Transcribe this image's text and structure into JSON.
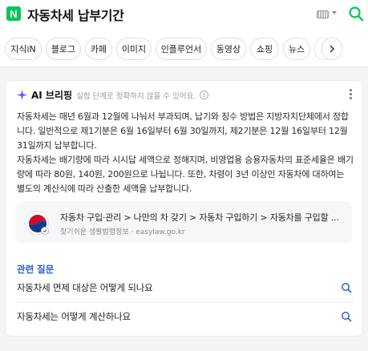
{
  "header": {
    "logo_letter": "N",
    "query": "자동차세 납부기간",
    "icons": [
      "keyboard-icon",
      "dropdown-caret-icon",
      "search-icon"
    ],
    "brand_color": "#03c75a"
  },
  "tabs": [
    {
      "label": "지식iN"
    },
    {
      "label": "블로그"
    },
    {
      "label": "카페"
    },
    {
      "label": "이미지"
    },
    {
      "label": "인플루언서"
    },
    {
      "label": "동영상"
    },
    {
      "label": "쇼핑"
    },
    {
      "label": "뉴스"
    },
    {
      "label": "쇼"
    }
  ],
  "ai_briefing": {
    "title": "AI 브리핑",
    "subtitle": "실험 단계로 정확하지 않을 수 있어요.",
    "paragraphs": [
      "자동차세는 매년 6월과 12월에 나눠서 부과되며, 납기와 징수 방법은 지방자치단체에서 정합니다. 일반적으로 제1기분은 6월 16일부터 6월 30일까지, 제2기분은 12월 16일부터 12월 31일까지 납부합니다.",
      "자동차세는 배기량에 따라 시시답 세액으로 정해지며, 비영업용 승용자동차의 표준세율은 배기량에 따라 80원, 140원, 200원으로 나뉩니다. 또한, 차령이 3년 이상인 자동차에 대하여는 별도의 계산식에 따라 산출한 세액을 납부합니다."
    ],
    "source": {
      "title": "자동차 구입·관리 > 나만의 차 갖기 > 자동차 구입하기 > 자동차를 구입할 ...",
      "site": "찾기쉬운 생활법령정보",
      "domain": "easylaw.go.kr",
      "separator": "·"
    },
    "related": {
      "title": "관련 질문",
      "items": [
        "자동차세 면제 대상은 어떻게 되나요",
        "자동차세는 어떻게 계산하나요"
      ]
    },
    "accent_color": "#2d5dcc"
  }
}
